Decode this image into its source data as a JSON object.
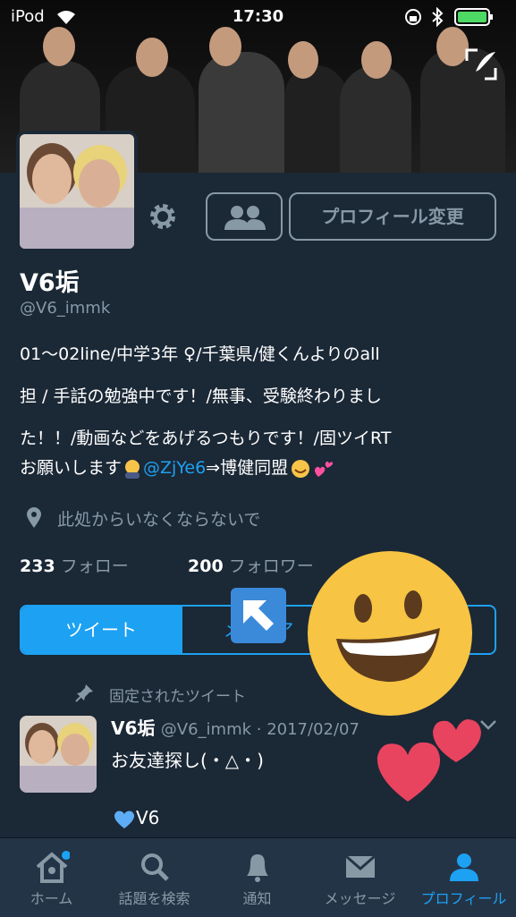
{
  "status_bar": {
    "carrier": "iPod",
    "time": "17:30"
  },
  "profile": {
    "name": "V6垢",
    "handle": "@V6_immk",
    "bio_line1": "01〜02line/中学3年 ♀/千葉県/健くんよりのall",
    "bio_line2": "担 / 手話の勉強中です！/無事、受験終わりまし",
    "bio_line3": "た！！/動画などをあげるつもりです！/固ツイRT",
    "bio_line4_pre": "お願いします",
    "bio_mention": "@ZjYe6",
    "bio_line4_post": "⇒博健同盟",
    "location": "此処からいなくならないで",
    "following_count": "233",
    "following_label": "フォロー",
    "followers_count": "200",
    "followers_label": "フォロワー",
    "edit_button": "プロフィール変更"
  },
  "tabs": {
    "tweets": "ツイート",
    "media": "メディア"
  },
  "pinned": {
    "label": "固定されたツイート",
    "name": "V6垢",
    "meta": "@V6_immk · 2017/02/07",
    "text": "お友達探し(・△・)",
    "text2": "V6"
  },
  "bottom_nav": {
    "home": "ホーム",
    "search": "話題を検索",
    "notifications": "通知",
    "messages": "メッセージ",
    "profile": "プロフィール"
  },
  "colors": {
    "accent": "#1da1f2",
    "background": "#1b2836",
    "dim": "#8899a6"
  }
}
